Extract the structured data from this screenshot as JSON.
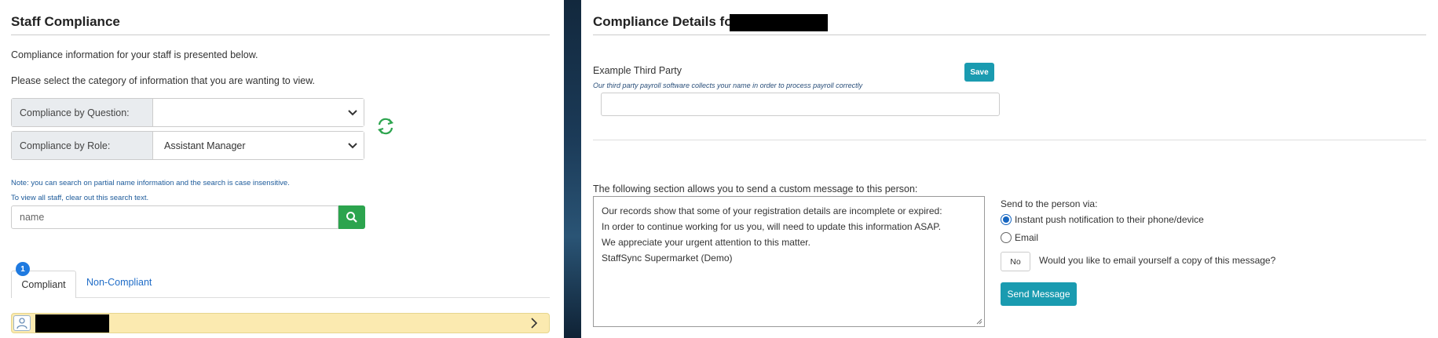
{
  "left": {
    "title": "Staff Compliance",
    "intro": "Compliance information for your staff is presented below.",
    "instruction": "Please select the category of information that you are wanting to view.",
    "by_question": {
      "label": "Compliance by Question:",
      "value": ""
    },
    "by_role": {
      "label": "Compliance by Role:",
      "value": "Assistant Manager"
    },
    "note1": "Note: you can search on partial name information and the search is case insensitive.",
    "note2": "To view all staff, clear out this search text.",
    "search": {
      "placeholder": "name"
    },
    "tabs": [
      {
        "label": "Compliant",
        "badge": "1",
        "active": true
      },
      {
        "label": "Non-Compliant",
        "active": false
      }
    ],
    "colors": {
      "accent_green": "#2ca44e",
      "badge_blue": "#1f7ae0",
      "row_yellow": "#fbeab0"
    }
  },
  "right": {
    "title": "Compliance Details for",
    "third_party": {
      "label": "Example Third Party",
      "save_label": "Save",
      "description": "Our third party payroll software collects your name in order to process payroll correctly",
      "value": ""
    },
    "message_intro": "The following section allows you to send a custom message to this person:",
    "message_lines": [
      "Our records show that some of your registration details are incomplete or expired:",
      "In order to continue working for us you, will need to update this information ASAP.",
      "We appreciate your urgent attention to this matter.",
      "StaffSync Supermarket (Demo)"
    ],
    "send_via_label": "Send to the person via:",
    "send_options": [
      {
        "label": "Instant push notification to their phone/device",
        "selected": true
      },
      {
        "label": "Email",
        "selected": false
      }
    ],
    "email_copy_toggle": "No",
    "email_copy_question": "Would you like to email yourself a copy of this message?",
    "send_button": "Send Message",
    "colors": {
      "teal": "#1a9bb0"
    }
  }
}
